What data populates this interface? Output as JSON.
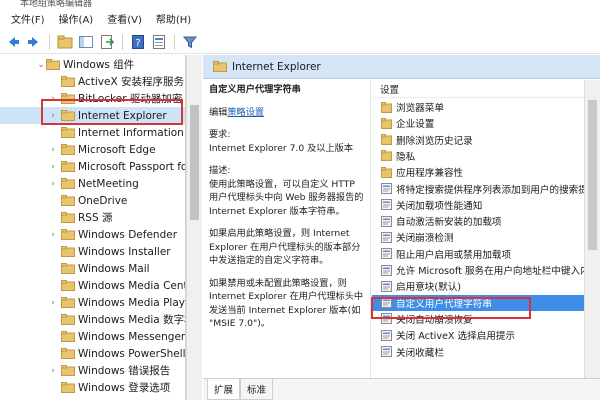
{
  "window": {
    "title": "本地组策略编辑器"
  },
  "menu": [
    "文件(F)",
    "操作(A)",
    "查看(V)",
    "帮助(H)"
  ],
  "toolbar": [
    "back-icon",
    "forward-icon",
    "folder-up-icon",
    "show-tree-icon",
    "export-icon",
    "help-icon",
    "properties-icon",
    "filter-icon"
  ],
  "tree": {
    "parent": "Windows 组件",
    "items": [
      {
        "label": "ActiveX 安装程序服务",
        "expandable": false
      },
      {
        "label": "BitLocker 驱动器加密",
        "expandable": true
      },
      {
        "label": "Internet Explorer",
        "expandable": true,
        "selected": true
      },
      {
        "label": "Internet Information Se",
        "expandable": false
      },
      {
        "label": "Microsoft Edge",
        "expandable": true
      },
      {
        "label": "Microsoft Passport for",
        "expandable": true
      },
      {
        "label": "NetMeeting",
        "expandable": true
      },
      {
        "label": "OneDrive",
        "expandable": false
      },
      {
        "label": "RSS 源",
        "expandable": false
      },
      {
        "label": "Windows Defender",
        "expandable": true
      },
      {
        "label": "Windows Installer",
        "expandable": false
      },
      {
        "label": "Windows Mail",
        "expandable": false
      },
      {
        "label": "Windows Media Center",
        "expandable": false
      },
      {
        "label": "Windows Media Player",
        "expandable": true
      },
      {
        "label": "Windows Media 数字权",
        "expandable": false
      },
      {
        "label": "Windows Messenger",
        "expandable": false
      },
      {
        "label": "Windows PowerShell",
        "expandable": false
      },
      {
        "label": "Windows 错误报告",
        "expandable": true
      },
      {
        "label": "Windows 登录选项",
        "expandable": false
      }
    ]
  },
  "right": {
    "header": "Internet Explorer",
    "description": {
      "title": "自定义用户代理字符串",
      "edit_prefix": "编辑",
      "edit_link": "策略设置",
      "req_label": "要求:",
      "req_text": "Internet Explorer 7.0 及以上版本",
      "desc_label": "描述:",
      "desc_text": "使用此策略设置，可以自定义 HTTP 用户代理标头中向 Web 服务器报告的 Internet Explorer 版本字符串。",
      "enabled_text": "如果启用此策略设置，则 Internet Explorer 在用户代理标头的版本部分中发送指定的自定义字符串。",
      "disabled_text": "如果禁用或未配置此策略设置，则 Internet Explorer 在用户代理标头中发送当前 Internet Explorer 版本(如 \"MSIE 7.0\")。"
    },
    "settings_header": "设置",
    "settings": [
      {
        "label": "浏览器菜单",
        "type": "folder"
      },
      {
        "label": "企业设置",
        "type": "folder"
      },
      {
        "label": "删除浏览历史记录",
        "type": "folder"
      },
      {
        "label": "隐私",
        "type": "folder"
      },
      {
        "label": "应用程序兼容性",
        "type": "folder"
      },
      {
        "label": "将特定搜索提供程序列表添加到用户的搜索提供",
        "type": "setting"
      },
      {
        "label": "关闭加载项性能通知",
        "type": "setting"
      },
      {
        "label": "自动激活新安装的加载项",
        "type": "setting"
      },
      {
        "label": "关闭崩溃检测",
        "type": "setting"
      },
      {
        "label": "阻止用户启用或禁用加载项",
        "type": "setting"
      },
      {
        "label": "允许 Microsoft 服务在用户向地址栏中键入内容",
        "type": "setting"
      },
      {
        "label": "启用意块(默认)",
        "type": "setting"
      },
      {
        "label": "自定义用户代理字符串",
        "type": "setting",
        "selected": true
      },
      {
        "label": "关闭自动崩溃恢复",
        "type": "setting"
      },
      {
        "label": "关闭 ActiveX 选择启用提示",
        "type": "setting"
      },
      {
        "label": "关闭收藏栏",
        "type": "setting"
      }
    ],
    "tabs": [
      "扩展",
      "标准"
    ]
  },
  "colors": {
    "selection": "#3e8ee9",
    "highlight_box": "#d8323a",
    "header_bg": "#d6e5f5",
    "folder": "#e8c56a"
  }
}
